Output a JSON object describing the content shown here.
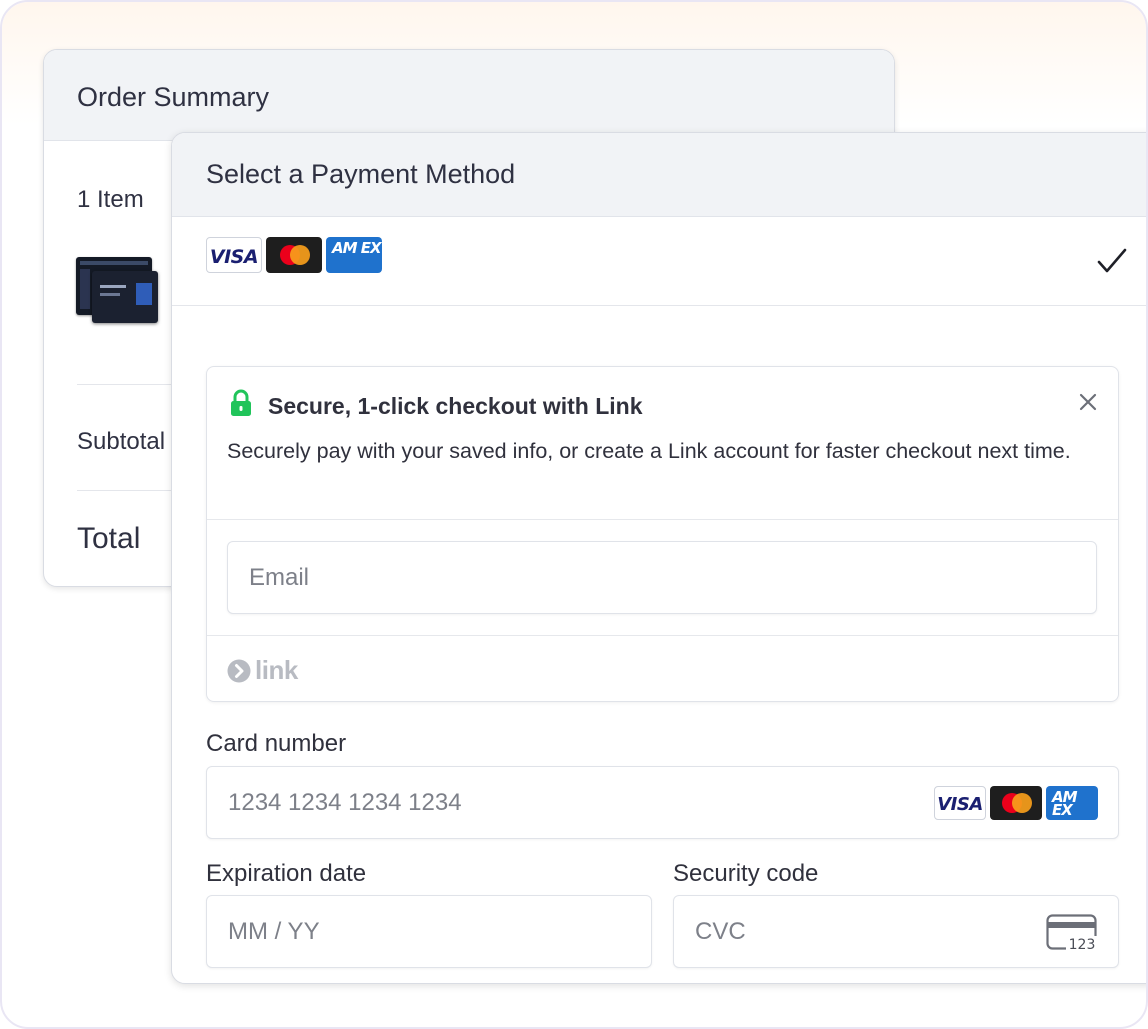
{
  "order_summary": {
    "title": "Order Summary",
    "items_count": "1 Item",
    "subtotal_label": "Subtotal",
    "total_label": "Total"
  },
  "payment": {
    "title": "Select a Payment Method",
    "brands": [
      "VISA",
      "Mastercard",
      "AMEX"
    ],
    "selected": true,
    "link": {
      "title": "Secure, 1-click checkout with Link",
      "description": "Securely pay with your saved info, or create a Link account for faster checkout next time.",
      "email_placeholder": "Email",
      "wordmark": "link"
    },
    "card_number": {
      "label": "Card number",
      "placeholder": "1234 1234 1234 1234"
    },
    "expiration": {
      "label": "Expiration date",
      "placeholder": "MM / YY"
    },
    "security_code": {
      "label": "Security code",
      "placeholder": "CVC",
      "icon_text": "123"
    }
  },
  "logo_text": {
    "visa": "VISA",
    "amex": "AM EX"
  },
  "colors": {
    "link_green": "#20c45a",
    "visa_blue": "#1a1f71",
    "amex_blue": "#1f72cd",
    "mc_red": "#eb001b",
    "mc_orange": "#f79e1b"
  }
}
